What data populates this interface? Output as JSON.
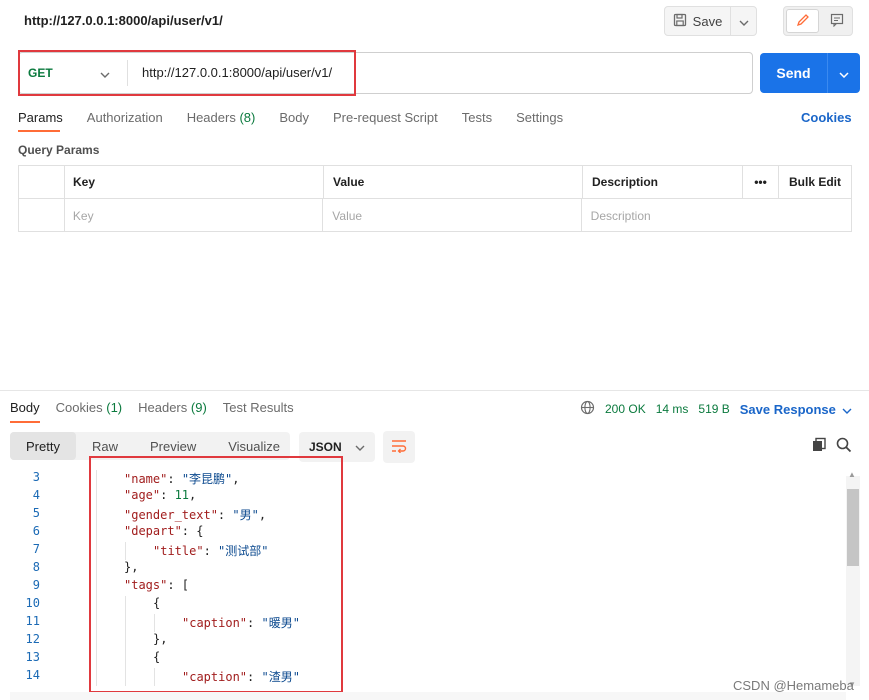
{
  "request": {
    "title": "http://127.0.0.1:8000/api/user/v1/",
    "save_label": "Save",
    "method": "GET",
    "url": "http://127.0.0.1:8000/api/user/v1/",
    "send_label": "Send"
  },
  "tabs": [
    {
      "label": "Params",
      "count": ""
    },
    {
      "label": "Authorization",
      "count": ""
    },
    {
      "label": "Headers",
      "count": "(8)"
    },
    {
      "label": "Body",
      "count": ""
    },
    {
      "label": "Pre-request Script",
      "count": ""
    },
    {
      "label": "Tests",
      "count": ""
    },
    {
      "label": "Settings",
      "count": ""
    }
  ],
  "cookies_label": "Cookies",
  "query_params": {
    "label": "Query Params",
    "headers": {
      "key": "Key",
      "value": "Value",
      "description": "Description",
      "more": "•••",
      "bulk_edit": "Bulk Edit"
    },
    "placeholders": {
      "key": "Key",
      "value": "Value",
      "description": "Description"
    }
  },
  "response": {
    "tabs": [
      {
        "label": "Body",
        "count": ""
      },
      {
        "label": "Cookies",
        "count": "(1)"
      },
      {
        "label": "Headers",
        "count": "(9)"
      },
      {
        "label": "Test Results",
        "count": ""
      }
    ],
    "status": "200 OK",
    "time": "14 ms",
    "size": "519 B",
    "save_response": "Save Response",
    "formats": [
      "Pretty",
      "Raw",
      "Preview",
      "Visualize"
    ],
    "language": "JSON",
    "lines": [
      {
        "n": "3",
        "indent": 1,
        "parts": [
          [
            "key",
            "\"name\""
          ],
          [
            "p",
            ": "
          ],
          [
            "str",
            "\"李昆鹏\""
          ],
          [
            "p",
            ","
          ]
        ]
      },
      {
        "n": "4",
        "indent": 1,
        "parts": [
          [
            "key",
            "\"age\""
          ],
          [
            "p",
            ": "
          ],
          [
            "num",
            "11"
          ],
          [
            "p",
            ","
          ]
        ]
      },
      {
        "n": "5",
        "indent": 1,
        "parts": [
          [
            "key",
            "\"gender_text\""
          ],
          [
            "p",
            ": "
          ],
          [
            "str",
            "\"男\""
          ],
          [
            "p",
            ","
          ]
        ]
      },
      {
        "n": "6",
        "indent": 1,
        "parts": [
          [
            "key",
            "\"depart\""
          ],
          [
            "p",
            ": {"
          ]
        ]
      },
      {
        "n": "7",
        "indent": 2,
        "parts": [
          [
            "key",
            "\"title\""
          ],
          [
            "p",
            ": "
          ],
          [
            "str",
            "\"测试部\""
          ]
        ]
      },
      {
        "n": "8",
        "indent": 1,
        "parts": [
          [
            "p",
            "},"
          ]
        ]
      },
      {
        "n": "9",
        "indent": 1,
        "parts": [
          [
            "key",
            "\"tags\""
          ],
          [
            "p",
            ": ["
          ]
        ]
      },
      {
        "n": "10",
        "indent": 2,
        "parts": [
          [
            "p",
            "{"
          ]
        ]
      },
      {
        "n": "11",
        "indent": 3,
        "parts": [
          [
            "key",
            "\"caption\""
          ],
          [
            "p",
            ": "
          ],
          [
            "str",
            "\"暖男\""
          ]
        ]
      },
      {
        "n": "12",
        "indent": 2,
        "parts": [
          [
            "p",
            "},"
          ]
        ]
      },
      {
        "n": "13",
        "indent": 2,
        "parts": [
          [
            "p",
            "{"
          ]
        ]
      },
      {
        "n": "14",
        "indent": 3,
        "parts": [
          [
            "key",
            "\"caption\""
          ],
          [
            "p",
            ": "
          ],
          [
            "str",
            "\"渣男\""
          ]
        ]
      }
    ]
  },
  "watermark": "CSDN @Hemameba",
  "colors": {
    "accent": "#ff6c37",
    "send": "#1a73e8",
    "status_green": "#0b7a3e",
    "highlight": "#e0393e"
  }
}
